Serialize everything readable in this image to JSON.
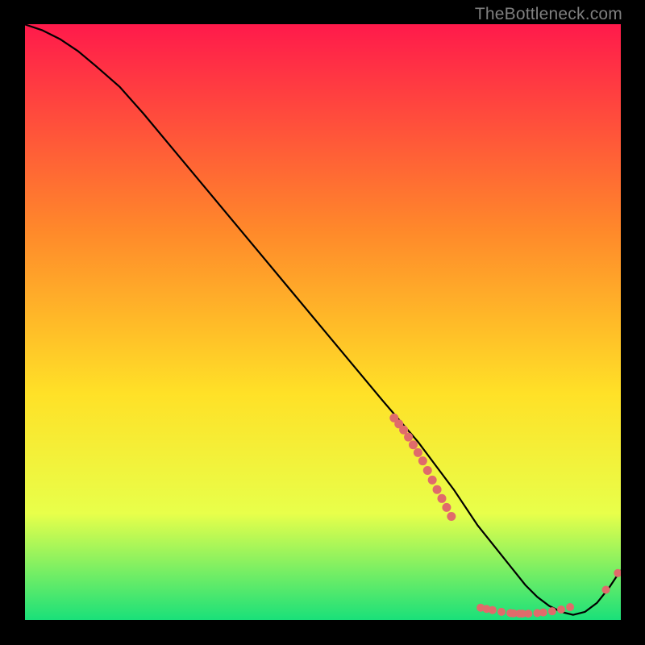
{
  "watermark": "TheBottleneck.com",
  "colors": {
    "gradient_top": "#ff1a4b",
    "gradient_mid1": "#ff8a2a",
    "gradient_mid2": "#ffe127",
    "gradient_mid3": "#e8ff4a",
    "gradient_bottom": "#18e07a",
    "curve": "#000000",
    "dot": "#e06b6b",
    "axis": "#000000"
  },
  "chart_data": {
    "type": "line",
    "title": "",
    "xlabel": "",
    "ylabel": "",
    "xlim": [
      0,
      100
    ],
    "ylim": [
      0,
      100
    ],
    "annotations": [],
    "series": [
      {
        "name": "bottleneck-curve",
        "x": [
          0,
          3,
          6,
          9,
          12,
          16,
          20,
          25,
          30,
          35,
          40,
          45,
          50,
          55,
          60,
          63,
          66,
          69,
          72,
          74,
          76,
          78,
          80,
          82,
          84,
          86,
          88,
          90,
          92,
          94,
          96,
          98,
          100
        ],
        "y": [
          100,
          99,
          97.5,
          95.5,
          93,
          89.5,
          85,
          79,
          73,
          67,
          61,
          55,
          49,
          43,
          37,
          33.5,
          30,
          26,
          22,
          19,
          16,
          13.5,
          11,
          8.5,
          6,
          4,
          2.5,
          1.5,
          1,
          1.5,
          3,
          5.5,
          8.5
        ]
      },
      {
        "name": "dots-cluster-descent",
        "x": [
          62,
          62.8,
          63.6,
          64.4,
          65.2,
          66,
          66.8,
          67.6,
          68.4,
          69.2,
          70,
          70.8,
          71.6
        ],
        "y": [
          34,
          33,
          32,
          30.8,
          29.5,
          28.2,
          26.8,
          25.2,
          23.6,
          22,
          20.5,
          19,
          17.5
        ]
      },
      {
        "name": "dots-cluster-valley",
        "x": [
          76.5,
          77.5,
          78.5,
          80,
          81.5,
          82,
          83,
          83.5,
          84.5,
          86,
          87,
          88.5,
          90,
          91.5
        ],
        "y": [
          2.2,
          2.0,
          1.8,
          1.5,
          1.3,
          1.25,
          1.2,
          1.2,
          1.2,
          1.3,
          1.4,
          1.6,
          1.9,
          2.3
        ]
      },
      {
        "name": "dots-cluster-rise",
        "x": [
          97.5,
          99.5
        ],
        "y": [
          5.2,
          8.0
        ]
      }
    ]
  }
}
